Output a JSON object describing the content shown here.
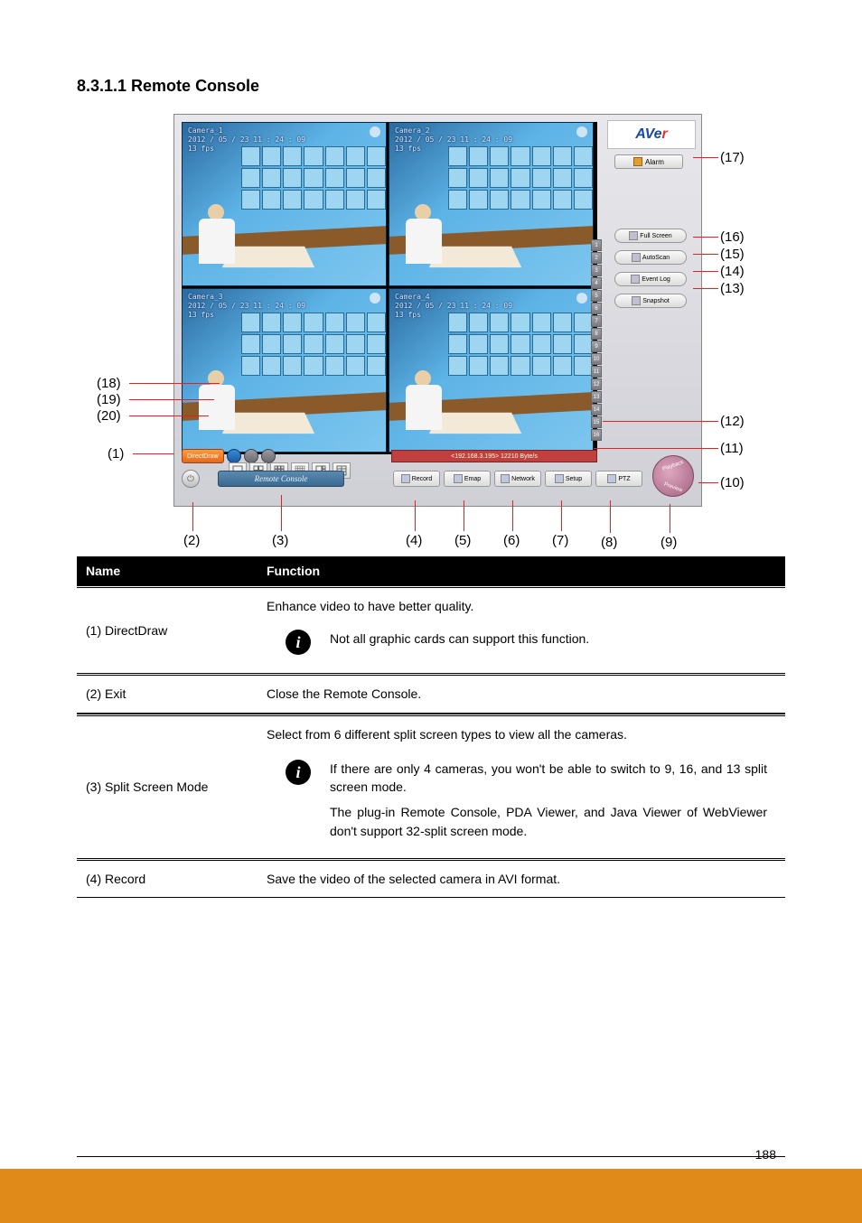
{
  "section_title": "8.3.1.1 Remote Console",
  "figure": {
    "logo_main": "AVe",
    "logo_accent": "r",
    "cameras": [
      {
        "label": "Camera_1",
        "time": "2012 / 05 / 23  11 : 24 : 09",
        "fps": "13  fps"
      },
      {
        "label": "Camera_2",
        "time": "2012 / 05 / 23  11 : 24 : 09",
        "fps": "13  fps"
      },
      {
        "label": "Camera_3",
        "time": "2012 / 05 / 23  11 : 24 : 09",
        "fps": "13  fps"
      },
      {
        "label": "Camera_4",
        "time": "2012 / 05 / 23  11 : 24 : 09",
        "fps": "13  fps"
      }
    ],
    "side_buttons": {
      "alarm": "Alarm",
      "fullscreen": "Full Screen",
      "autoscan": "AutoScan",
      "eventlog": "Event Log",
      "snapshot": "Snapshot"
    },
    "bottom_buttons": {
      "direct_draw": "DirectDraw",
      "remote_console": "Remote Console",
      "record": "Record",
      "emap": "Emap",
      "network": "Network",
      "setup": "Setup",
      "ptz": "PTZ"
    },
    "ip_bar": "<192.168.3.195> 12210 Byte/s",
    "eye": {
      "top": "Playback",
      "bottom": "Preview"
    },
    "cam_numbers": [
      "1",
      "2",
      "3",
      "4",
      "5",
      "6",
      "7",
      "8",
      "9",
      "10",
      "11",
      "12",
      "13",
      "14",
      "15",
      "16"
    ]
  },
  "callouts": {
    "c1": "(1)",
    "c2": "(2)",
    "c3": "(3)",
    "c4": "(4)",
    "c5": "(5)",
    "c6": "(6)",
    "c7": "(7)",
    "c8": "(8)",
    "c9": "(9)",
    "c10": "(10)",
    "c11": "(11)",
    "c12": "(12)",
    "c13": "(13)",
    "c14": "(14)",
    "c15": "(15)",
    "c16": "(16)",
    "c17": "(17)",
    "c18": "(18)",
    "c19": "(19)",
    "c20": "(20)"
  },
  "table": {
    "head_name": "Name",
    "head_func": "Function",
    "rows": [
      {
        "name": "(1) DirectDraw",
        "func": "Enhance video to have better quality.",
        "note": "Not all graphic cards can support this function."
      },
      {
        "name": "(2) Exit",
        "func": "Close the Remote Console."
      },
      {
        "name": "(3) Split Screen Mode",
        "func_lines": [
          "Select from 6 different split screen types to view all the cameras.",
          "If there are only 4 cameras, you won't be able to switch to 9, 16, and 13 split screen mode.",
          "The plug-in Remote Console, PDA Viewer, and Java Viewer of WebViewer don't support 32-split screen mode."
        ]
      },
      {
        "name": "(4) Record",
        "func": "Save the video of the selected camera in AVI format."
      }
    ]
  },
  "page_number": "188"
}
